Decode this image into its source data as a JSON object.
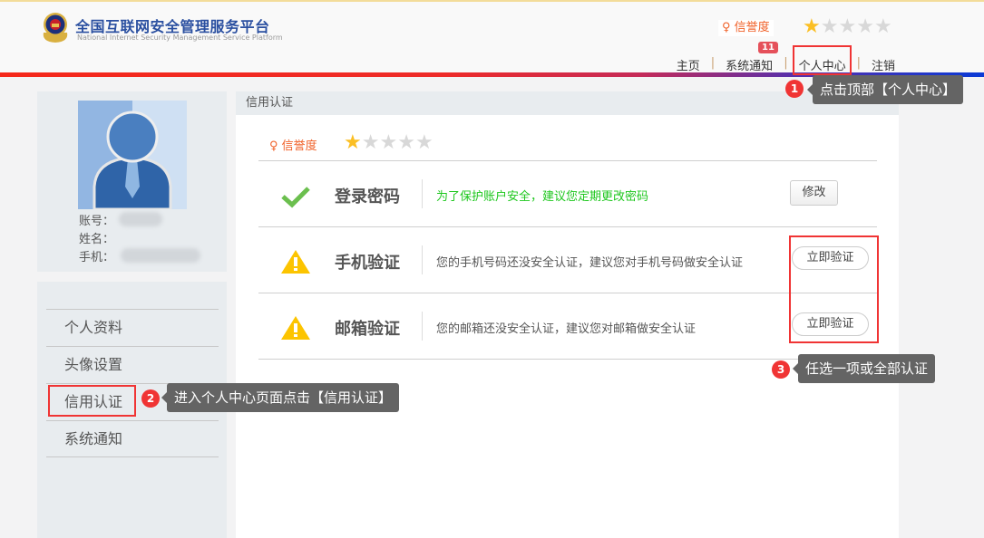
{
  "header": {
    "title": "全国互联网安全管理服务平台",
    "subtitle": "National Internet Security Management Service Platform",
    "credit_label": "信誉度",
    "credit_stars": 1,
    "credit_max": 5
  },
  "nav": {
    "items": [
      "主页",
      "系统通知",
      "个人中心",
      "注销"
    ],
    "notification_count": "11"
  },
  "profile": {
    "account_label": "账号：",
    "name_label": "姓名：",
    "phone_label": "手机："
  },
  "sidebar": {
    "items": [
      {
        "label": "个人资料"
      },
      {
        "label": "头像设置"
      },
      {
        "label": "信用认证",
        "active": true
      },
      {
        "label": "系统通知"
      }
    ]
  },
  "main": {
    "title": "信用认证",
    "credit_label": "信誉度",
    "credit_stars": 1,
    "rows": [
      {
        "icon": "check-icon",
        "title": "登录密码",
        "desc": "为了保护账户安全，建议您定期更改密码",
        "desc_color": "#1dc71d",
        "button": "修改"
      },
      {
        "icon": "warning-icon",
        "title": "手机验证",
        "desc": "您的手机号码还没安全认证，建议您对手机号码做安全认证",
        "button": "立即验证"
      },
      {
        "icon": "warning-icon",
        "title": "邮箱验证",
        "desc": "您的邮箱还没安全认证，建议您对邮箱做安全认证",
        "button": "立即验证"
      }
    ]
  },
  "callouts": [
    {
      "num": "1",
      "text": "点击顶部【个人中心】"
    },
    {
      "num": "2",
      "text": "进入个人中心页面点击【信用认证】"
    },
    {
      "num": "3",
      "text": "任选一项或全部认证"
    }
  ],
  "colors": {
    "accent": "#f0622a",
    "highlight": "#f03434",
    "star_on": "#fbbf24",
    "star_off": "#d8d8d8"
  }
}
